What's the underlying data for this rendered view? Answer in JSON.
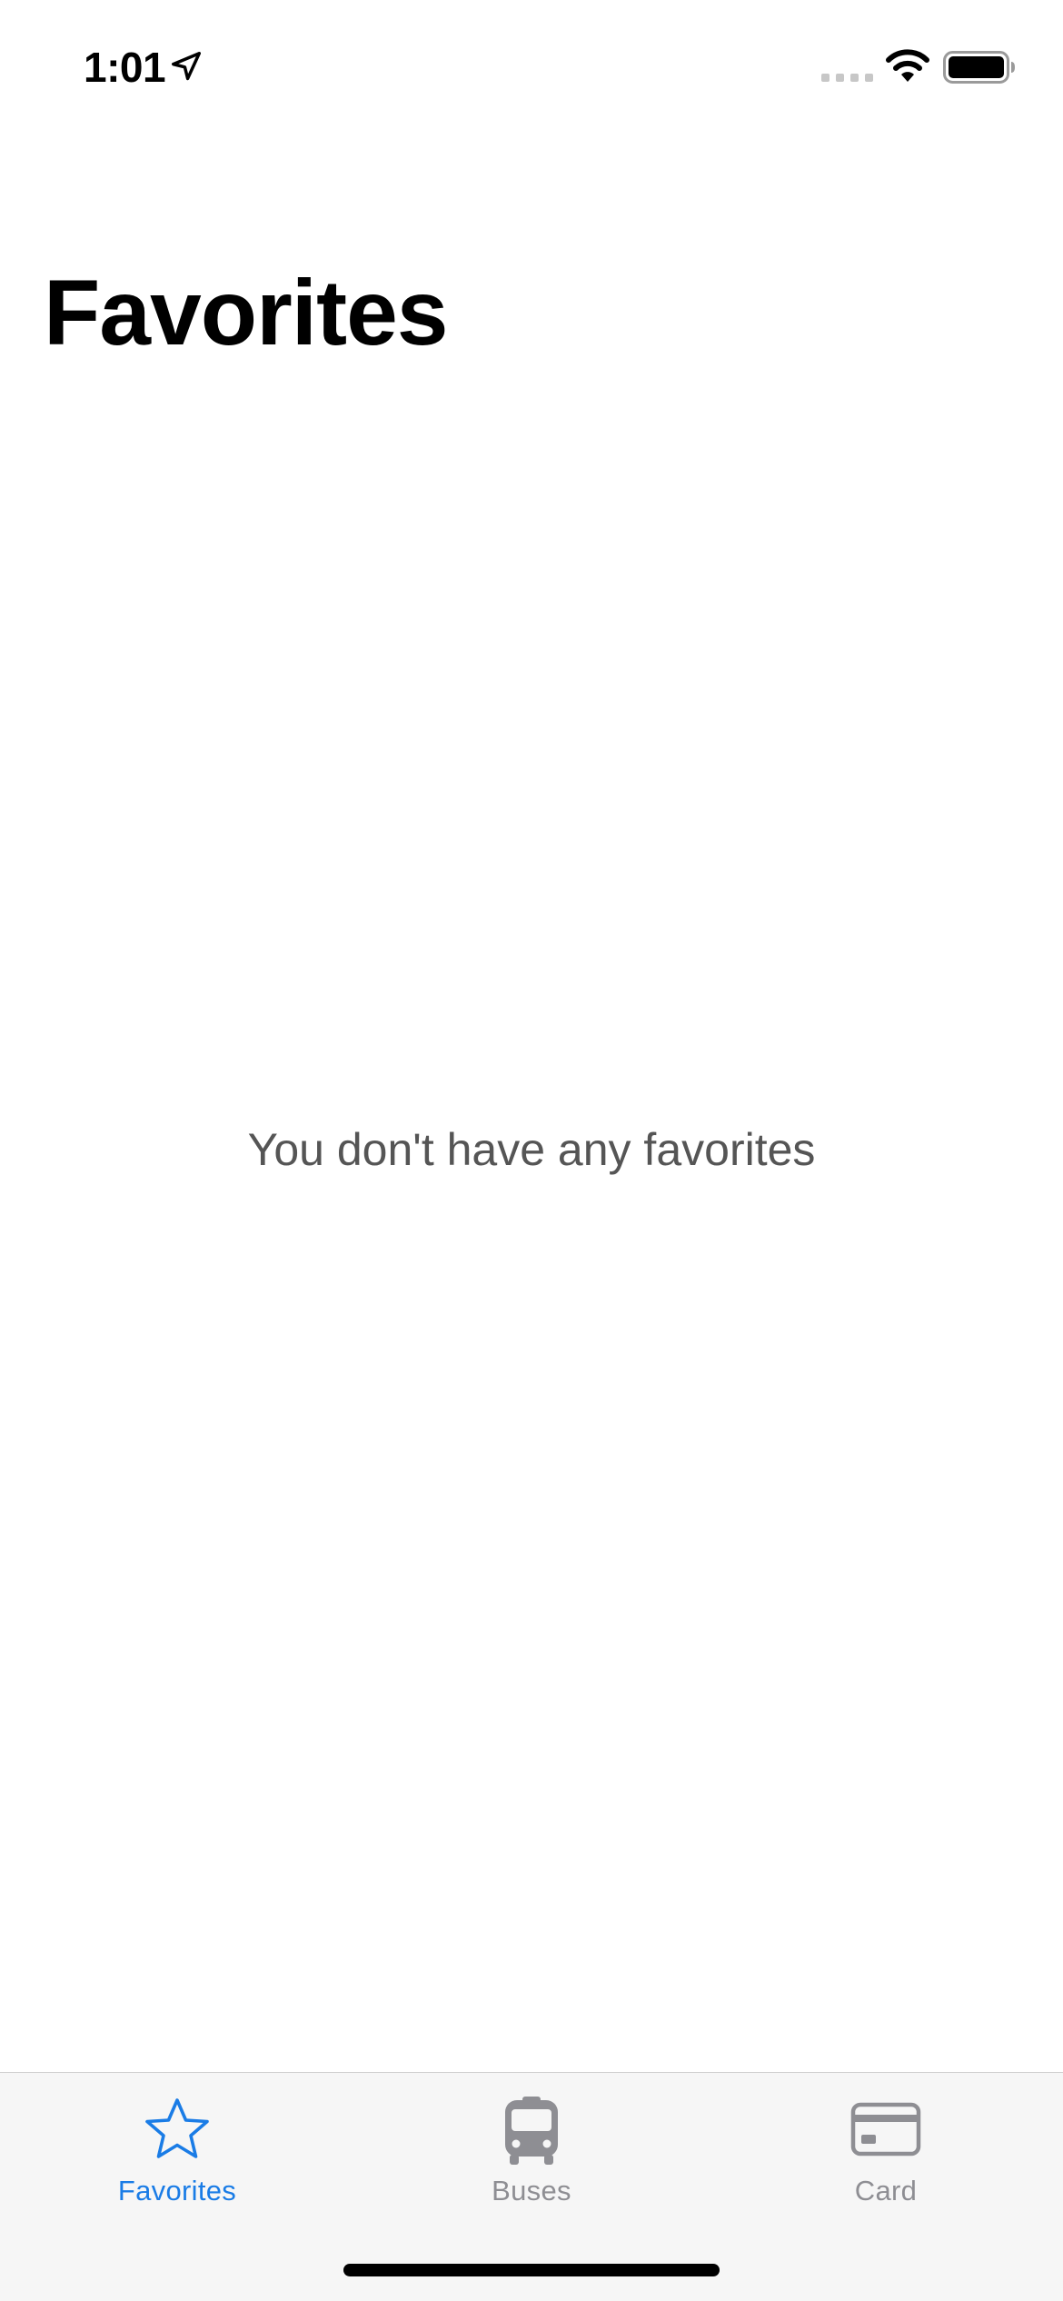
{
  "status_bar": {
    "time": "1:01"
  },
  "header": {
    "title": "Favorites"
  },
  "main": {
    "empty_message": "You don't have any favorites"
  },
  "tab_bar": {
    "tabs": [
      {
        "label": "Favorites",
        "icon": "star-icon",
        "selected": true
      },
      {
        "label": "Buses",
        "icon": "bus-icon",
        "selected": false
      },
      {
        "label": "Card",
        "icon": "credit-card-icon",
        "selected": false
      }
    ]
  },
  "colors": {
    "accent": "#1a7ce6",
    "inactive": "#8e8e93",
    "tab_bar_background": "#f6f6f6",
    "empty_text": "#555555"
  }
}
